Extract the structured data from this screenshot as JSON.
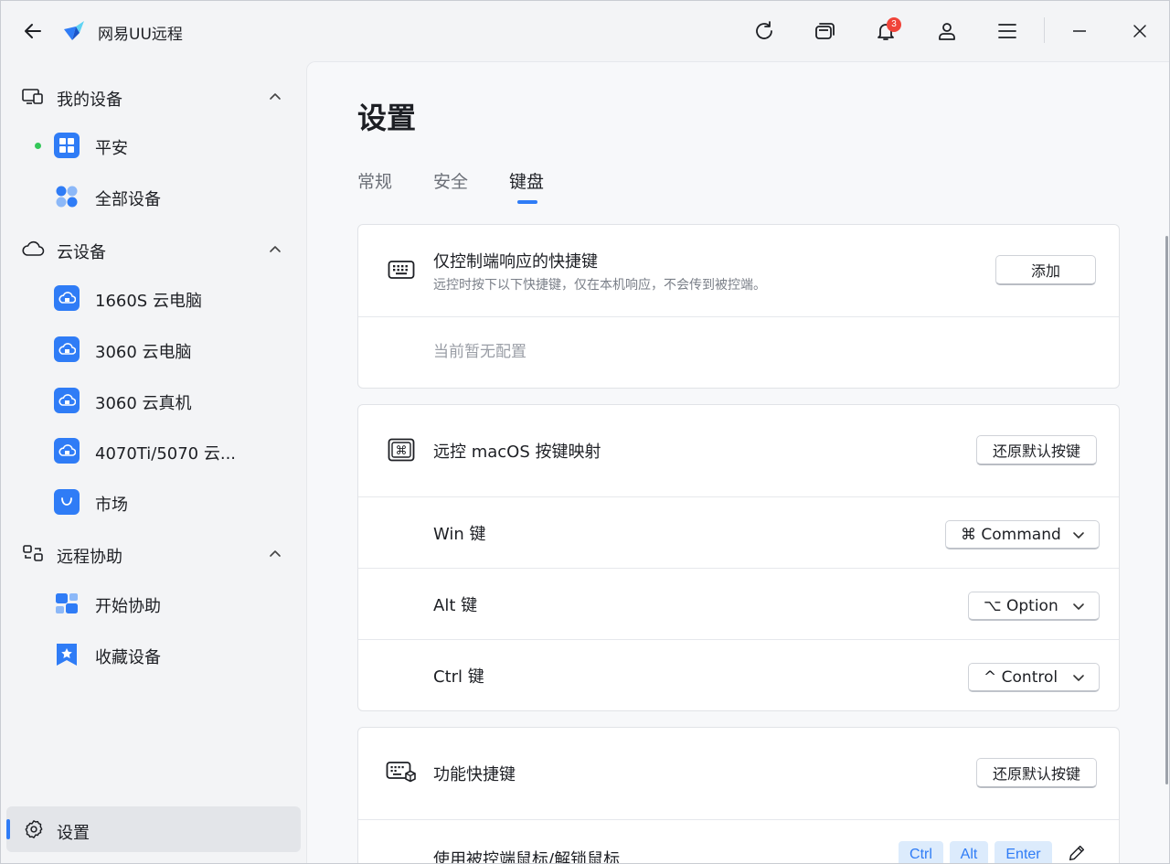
{
  "app": {
    "title": "网易UU远程",
    "notification_count": "3"
  },
  "sidebar": {
    "sections": [
      {
        "label": "我的设备",
        "icon": "devices-icon"
      },
      {
        "label": "云设备",
        "icon": "cloud-icon"
      },
      {
        "label": "远程协助",
        "icon": "remote-assist-icon"
      }
    ],
    "my_devices": [
      {
        "label": "平安",
        "icon": "windows-icon",
        "online": true
      },
      {
        "label": "全部设备",
        "icon": "all-devices-icon"
      }
    ],
    "cloud_devices": [
      {
        "label": "1660S 云电脑",
        "icon": "cloud-pc-icon"
      },
      {
        "label": "3060 云电脑",
        "icon": "cloud-pc-icon"
      },
      {
        "label": "3060 云真机",
        "icon": "cloud-pc-icon"
      },
      {
        "label": "4070Ti/5070 云...",
        "icon": "cloud-pc-icon"
      },
      {
        "label": "市场",
        "icon": "market-bag-icon"
      }
    ],
    "remote_assist": [
      {
        "label": "开始协助",
        "icon": "start-assist-icon"
      },
      {
        "label": "收藏设备",
        "icon": "favorite-star-icon"
      }
    ],
    "settings_label": "设置"
  },
  "main": {
    "title": "设置",
    "tabs": [
      {
        "label": "常规",
        "active": false
      },
      {
        "label": "安全",
        "active": false
      },
      {
        "label": "键盘",
        "active": true
      }
    ],
    "local_shortcuts": {
      "title": "仅控制端响应的快捷键",
      "subtitle": "远控时按下以下快捷键，仅在本机响应，不会传到被控端。",
      "add_label": "添加",
      "empty_text": "当前暂无配置"
    },
    "macos_mapping": {
      "title": "远控 macOS 按键映射",
      "reset_label": "还原默认按键",
      "rows": [
        {
          "label": "Win 键",
          "value": "⌘ Command"
        },
        {
          "label": "Alt 键",
          "value": "⌥ Option"
        },
        {
          "label": "Ctrl 键",
          "value": "^ Control"
        }
      ]
    },
    "function_shortcuts": {
      "title": "功能快捷键",
      "reset_label": "还原默认按键",
      "rows": [
        {
          "label": "使用被控端鼠标/解锁鼠标",
          "keys": [
            "Ctrl",
            "Alt",
            "Enter"
          ]
        }
      ]
    }
  },
  "colors": {
    "accent": "#2f7cf6",
    "online": "#34c759",
    "badge": "#f0443a"
  }
}
